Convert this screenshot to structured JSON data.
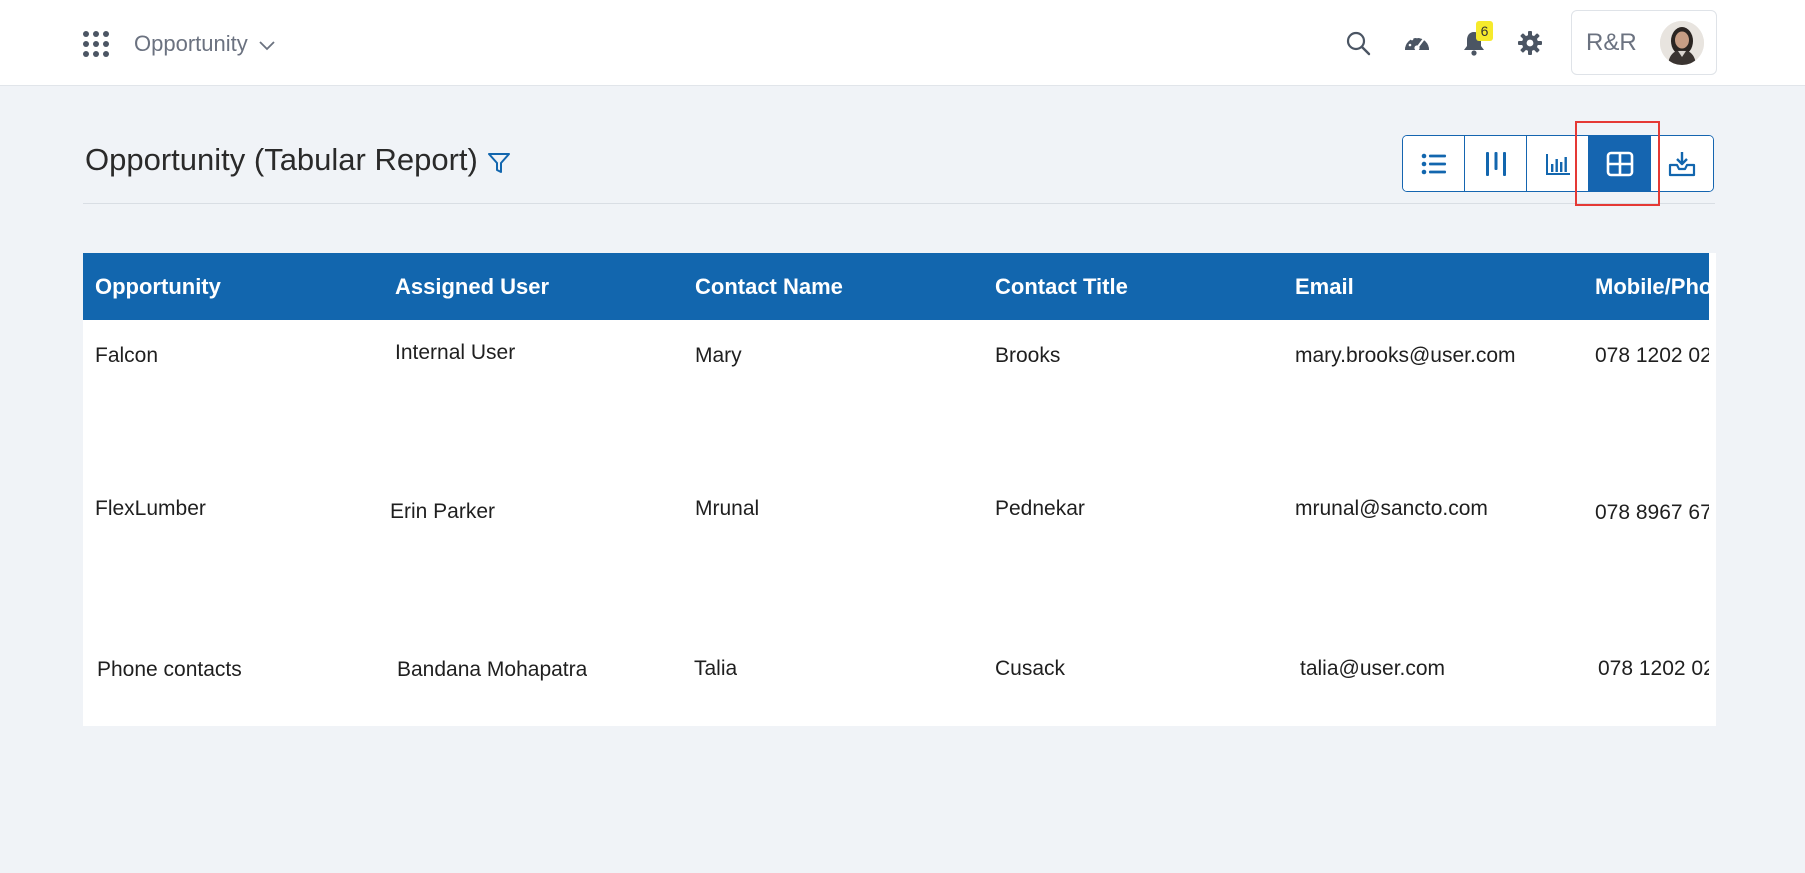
{
  "topbar": {
    "module_label": "Opportunity",
    "notification_count": "6",
    "user_initials": "R&R",
    "icons": [
      "apps-grid-icon",
      "search-icon",
      "dashboard-gauge-icon",
      "bell-icon",
      "gear-icon"
    ]
  },
  "page": {
    "title": "Opportunity (Tabular Report)",
    "view_buttons": [
      {
        "name": "list-view",
        "icon": "list-icon",
        "active": false
      },
      {
        "name": "kanban-view",
        "icon": "columns-icon",
        "active": false
      },
      {
        "name": "chart-view",
        "icon": "bar-chart-icon",
        "active": false
      },
      {
        "name": "table-view",
        "icon": "table-grid-icon",
        "active": true
      },
      {
        "name": "export",
        "icon": "download-tray-icon",
        "active": false
      }
    ]
  },
  "colors": {
    "primary": "#1266ae",
    "badge": "#f6ea2c",
    "highlight": "#e53935",
    "background": "#f0f3f7"
  },
  "table": {
    "columns": [
      "Opportunity",
      "Assigned User",
      "Contact Name",
      "Contact Title",
      "Email",
      "Mobile/Phone"
    ],
    "rows": [
      [
        "Falcon",
        "Internal User",
        "Mary",
        "Brooks",
        "mary.brooks@user.com",
        "078 1202 02"
      ],
      [
        "FlexLumber",
        "Erin Parker",
        "Mrunal",
        "Pednekar",
        "mrunal@sancto.com",
        "078 8967 67"
      ],
      [
        "Phone contacts",
        "Bandana Mohapatra",
        "Talia",
        "Cusack",
        "talia@user.com",
        "078 1202 02"
      ]
    ]
  }
}
